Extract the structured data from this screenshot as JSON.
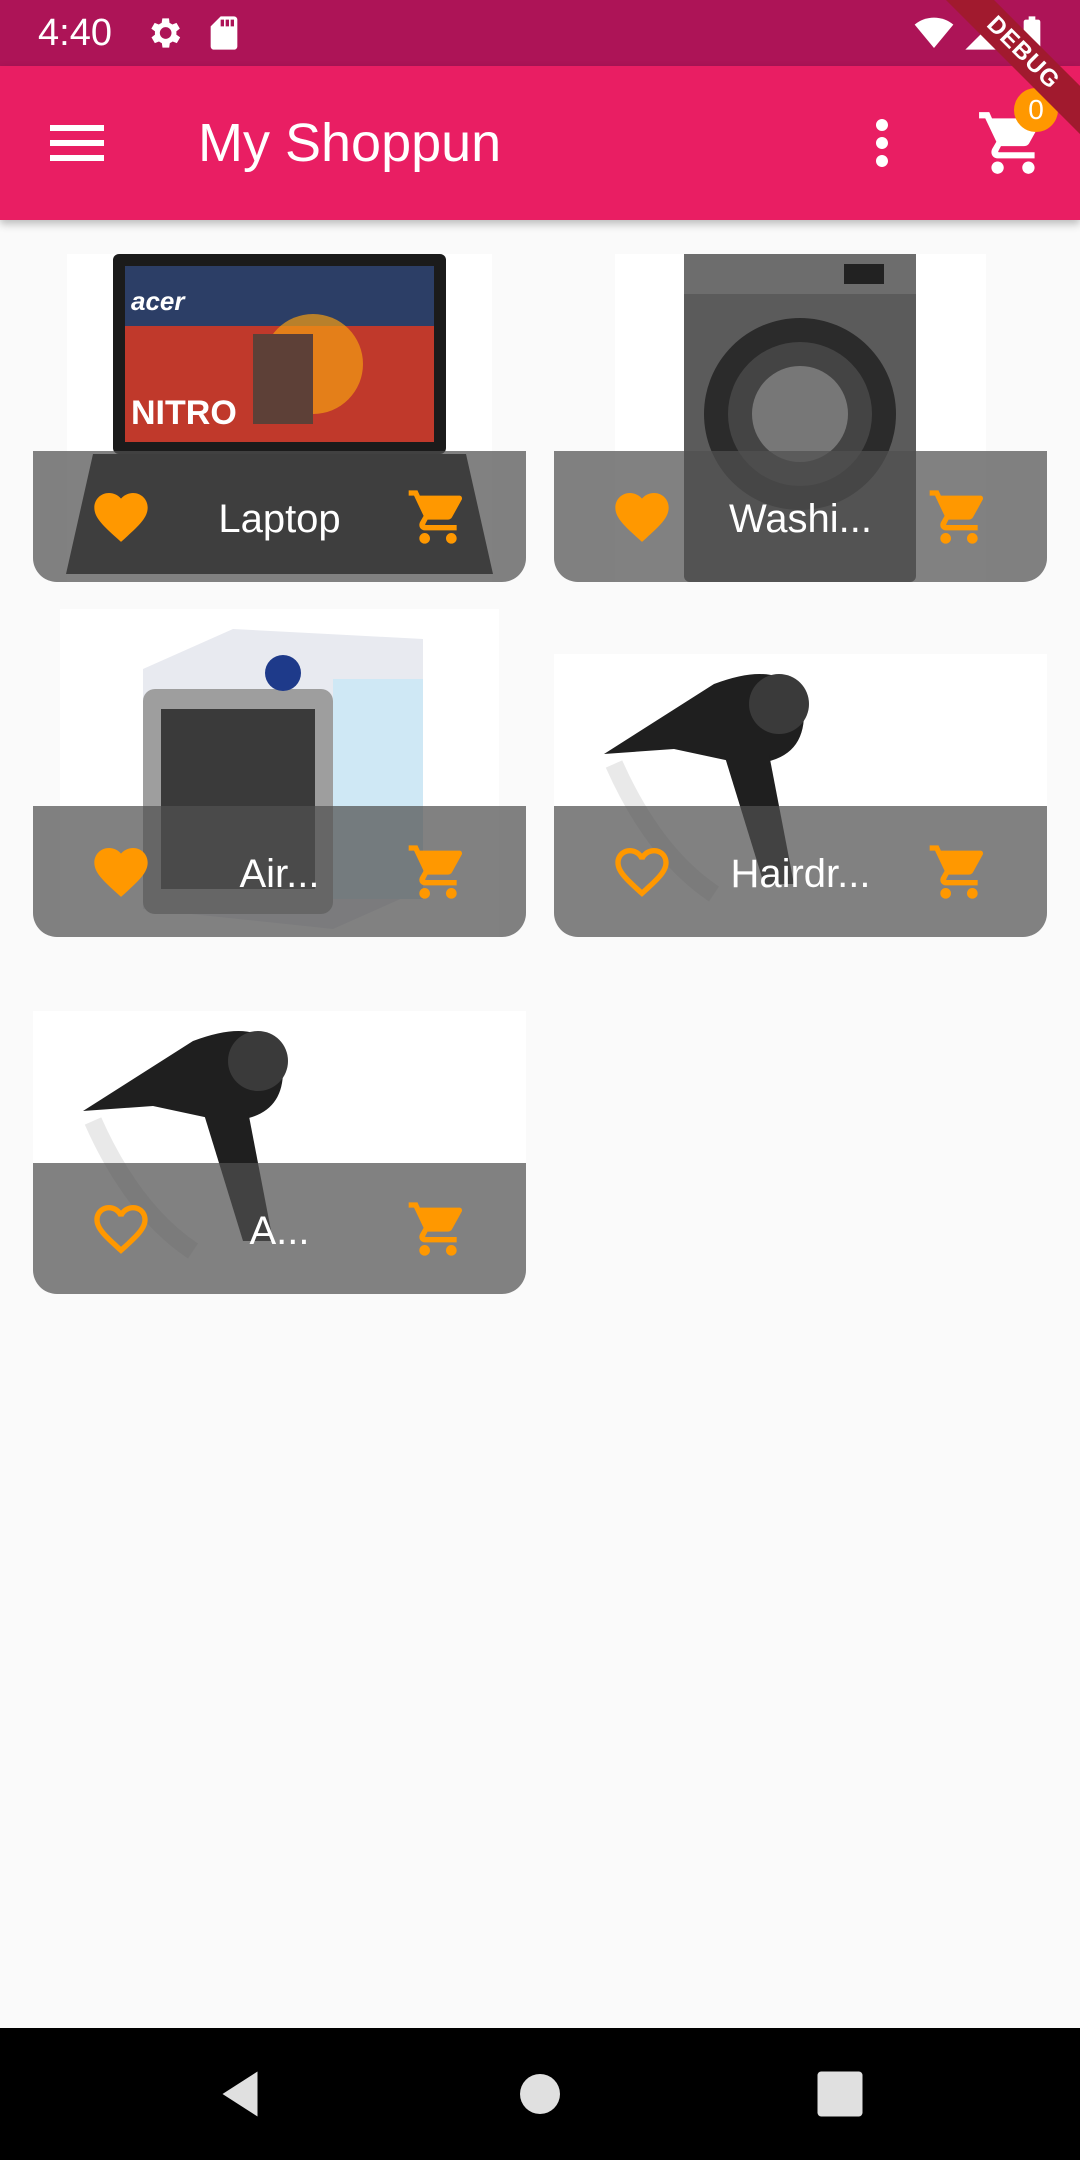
{
  "status_bar": {
    "time": "4:40",
    "icons": [
      "settings-icon",
      "sd-card-icon",
      "wifi-icon",
      "signal-icon",
      "battery-icon"
    ]
  },
  "app_bar": {
    "title": "My Shoppun",
    "menu_icon": "menu-icon",
    "overflow_icon": "more-vert-icon",
    "cart_icon": "cart-icon",
    "cart_badge": "0",
    "debug_label": "DEBUG"
  },
  "products": [
    {
      "name": "Laptop",
      "favorite": true,
      "image": "acer nitro laptop"
    },
    {
      "name": "Washi...",
      "favorite": true,
      "image": "LG washing machine"
    },
    {
      "name": "Air...",
      "favorite": true,
      "image": "portable air cooler"
    },
    {
      "name": "Hairdr...",
      "favorite": false,
      "image": "hairdryer"
    },
    {
      "name": "A...",
      "favorite": false,
      "image": "hairdryer"
    }
  ],
  "colors": {
    "status_bar": "#ad1457",
    "app_bar": "#e91e63",
    "accent": "#ff9800",
    "background": "#fafafa"
  },
  "nav_bar": {
    "icons": [
      "back-icon",
      "home-icon",
      "recents-icon"
    ]
  }
}
